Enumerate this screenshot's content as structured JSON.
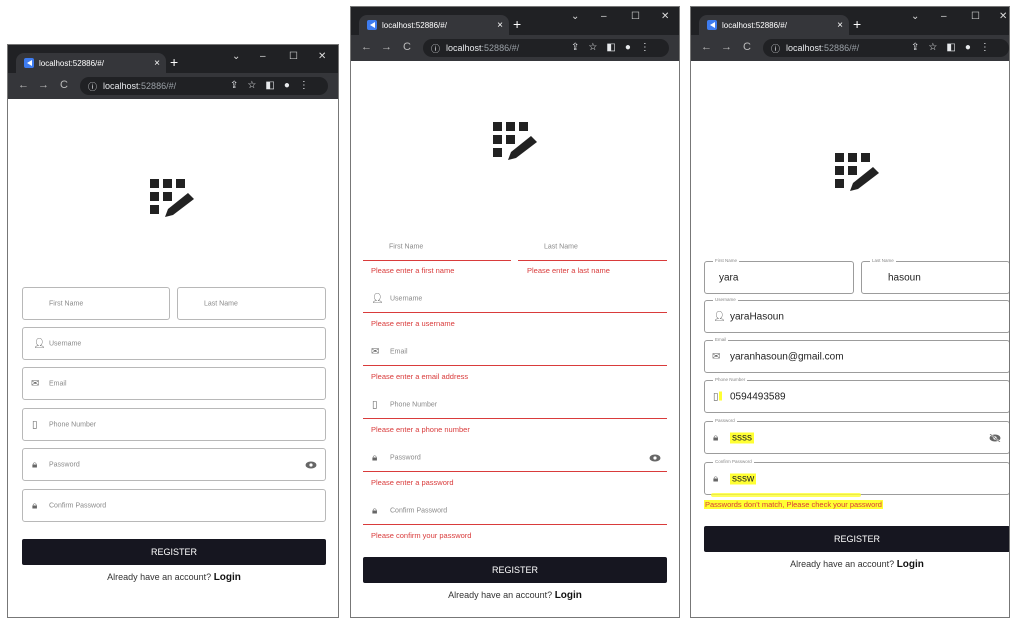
{
  "browser": {
    "tab_title": "localhost:52886/#/",
    "url_host": "localhost",
    "url_rest": ":52886/#/",
    "new_tab": "+",
    "close_tab": "×",
    "minimize": "–",
    "maximize": "☐",
    "close_window": "✕",
    "caret": "⌄"
  },
  "form_empty": {
    "first_name": "First Name",
    "last_name": "Last Name",
    "username": "Username",
    "email": "Email",
    "phone": "Phone Number",
    "password": "Password",
    "confirm_password": "Confirm Password",
    "register": "REGISTER",
    "already": "Already have an account?",
    "login": "Login"
  },
  "form_errors": {
    "first_name": "First Name",
    "last_name": "Last Name",
    "first_name_error": "Please enter a first name",
    "last_name_error": "Please enter a last name",
    "username": "Username",
    "username_error": "Please enter a username",
    "email": "Email",
    "email_error": "Please enter a email address",
    "phone": "Phone Number",
    "phone_error": "Please enter a phone number",
    "password": "Password",
    "password_error": "Please enter a password",
    "confirm_password": "Confirm Password",
    "confirm_error": "Please confirm your password",
    "register": "REGISTER",
    "already": "Already have an account?",
    "login": "Login"
  },
  "form_filled": {
    "first_name_label": "First Name",
    "first_name_value": "yara",
    "last_name_label": "Last Name",
    "last_name_value": "hasoun",
    "username_label": "Username",
    "username_value": "yaraHasoun",
    "email_label": "Email",
    "email_value": "yaranhasoun@gmail.com",
    "phone_label": "Phone Number",
    "phone_value": "0594493589",
    "password_label": "Password",
    "password_value": "ssss",
    "confirm_label": "Confirm Password",
    "confirm_value": "sssw",
    "mismatch_error": "Passwords don't match, Please check your password",
    "register": "REGISTER",
    "already": "Already have an account?",
    "login": "Login"
  },
  "colors": {
    "error": "#d93b3b",
    "button": "#161620",
    "highlight": "#ffff33"
  }
}
